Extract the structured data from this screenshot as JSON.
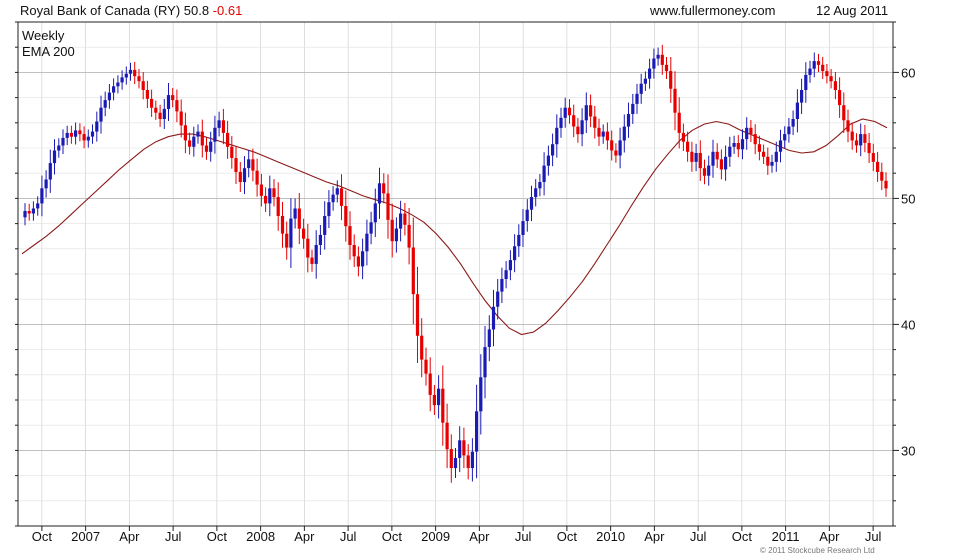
{
  "header": {
    "title": "Royal Bank of Canada (RY) 50.8",
    "change": "-0.61",
    "site": "www.fullermoney.com",
    "date": "12 Aug 2011"
  },
  "copyright": "© 2011 Stockcube Research Ltd",
  "colors": {
    "up": "#1a1ab4",
    "down": "#e60000",
    "ema": "#8b1a1a",
    "grid": "#c8c8c8",
    "axis": "#222222"
  },
  "chart_data": {
    "type": "candlestick",
    "grid": true,
    "legend_position": "top-left",
    "y_axis": {
      "position": "right",
      "ylim": [
        24,
        64
      ],
      "ticks": [
        30,
        40,
        50,
        60
      ]
    },
    "x_labels": [
      "Oct",
      "2007",
      "Apr",
      "Jul",
      "Oct",
      "2008",
      "Apr",
      "Jul",
      "Oct",
      "2009",
      "Apr",
      "Jul",
      "Oct",
      "2010",
      "Apr",
      "Jul",
      "Oct",
      "2011",
      "Apr",
      "Jul"
    ],
    "series": [
      {
        "name": "Weekly",
        "kind": "price",
        "closes": [
          49,
          48.8,
          49.2,
          49.6,
          50.8,
          51.5,
          52.8,
          53.8,
          54.2,
          54.8,
          55.2,
          54.9,
          55.4,
          55.1,
          54.6,
          54.9,
          55.3,
          56.1,
          57.2,
          57.8,
          58.4,
          58.9,
          59.2,
          59.6,
          59.9,
          60.2,
          59.7,
          59.3,
          58.6,
          57.9,
          57.2,
          56.8,
          56.3,
          57.1,
          58.2,
          57.8,
          56.9,
          55.8,
          54.6,
          54.1,
          54.9,
          55.3,
          54.2,
          53.7,
          54.5,
          55.6,
          56.2,
          55.2,
          54.1,
          53.2,
          52.1,
          51.3,
          52.4,
          53.1,
          52.2,
          51.1,
          50.2,
          49.6,
          50.8,
          50.1,
          48.6,
          47.2,
          46.1,
          48.4,
          49.2,
          47.6,
          46.8,
          45.3,
          44.8,
          46.3,
          47.1,
          48.6,
          49.7,
          50.3,
          50.8,
          49.4,
          47.8,
          46.3,
          45.4,
          44.6,
          45.8,
          47.2,
          48.1,
          49.6,
          51.2,
          50.4,
          48.3,
          46.6,
          47.6,
          48.8,
          47.9,
          46.1,
          42.4,
          39.1,
          37.2,
          36.1,
          34.4,
          33.6,
          34.9,
          32.2,
          30.1,
          28.6,
          29.4,
          30.8,
          29.6,
          28.6,
          29.9,
          33.1,
          35.8,
          38.2,
          39.6,
          41.4,
          42.6,
          43.6,
          44.3,
          45.1,
          46.2,
          47.1,
          48.2,
          49.1,
          50.1,
          50.8,
          51.3,
          52.6,
          53.4,
          54.3,
          55.6,
          56.4,
          57.2,
          56.6,
          55.7,
          55.1,
          56.2,
          57.4,
          56.5,
          55.6,
          54.9,
          55.3,
          54.6,
          53.8,
          53.4,
          54.6,
          55.7,
          56.7,
          57.5,
          58.3,
          59.1,
          59.5,
          60.3,
          61.1,
          61.4,
          60.6,
          60.1,
          58.7,
          56.8,
          55.2,
          54.5,
          53.7,
          52.9,
          53.6,
          52.4,
          51.8,
          52.6,
          53.7,
          53.1,
          52.3,
          53.3,
          54.1,
          54.4,
          53.9,
          54.7,
          55.6,
          55.1,
          54.3,
          53.7,
          53.3,
          52.6,
          52.9,
          53.7,
          54.6,
          55.1,
          55.7,
          56.3,
          57.6,
          58.6,
          59.8,
          60.3,
          60.9,
          60.6,
          60.1,
          59.7,
          59.3,
          58.6,
          57.4,
          56.2,
          55.3,
          54.6,
          54.2,
          55.1,
          54.4,
          53.6,
          52.9,
          52.1,
          51.4,
          50.8
        ]
      },
      {
        "name": "EMA 200",
        "kind": "ema",
        "values": [
          45.6,
          46.3,
          47,
          47.8,
          48.7,
          49.6,
          50.5,
          51.4,
          52.3,
          53.1,
          53.9,
          54.5,
          54.9,
          55.1,
          55.1,
          54.9,
          54.6,
          54.3,
          54,
          53.7,
          53.3,
          52.9,
          52.5,
          52.1,
          51.7,
          51.3,
          51,
          50.6,
          50.2,
          49.9,
          49.6,
          49.2,
          48.7,
          48.1,
          47.2,
          46.1,
          44.8,
          43.3,
          41.9,
          40.7,
          39.7,
          39.2,
          39.4,
          40.1,
          41.1,
          42.2,
          43.4,
          44.8,
          46.3,
          47.8,
          49.4,
          50.9,
          52.3,
          53.5,
          54.6,
          55.4,
          55.9,
          56.1,
          55.9,
          55.4,
          55,
          54.6,
          54.2,
          53.8,
          53.6,
          53.7,
          54.2,
          55,
          55.9,
          56.3,
          56.1,
          55.6
        ]
      }
    ]
  }
}
